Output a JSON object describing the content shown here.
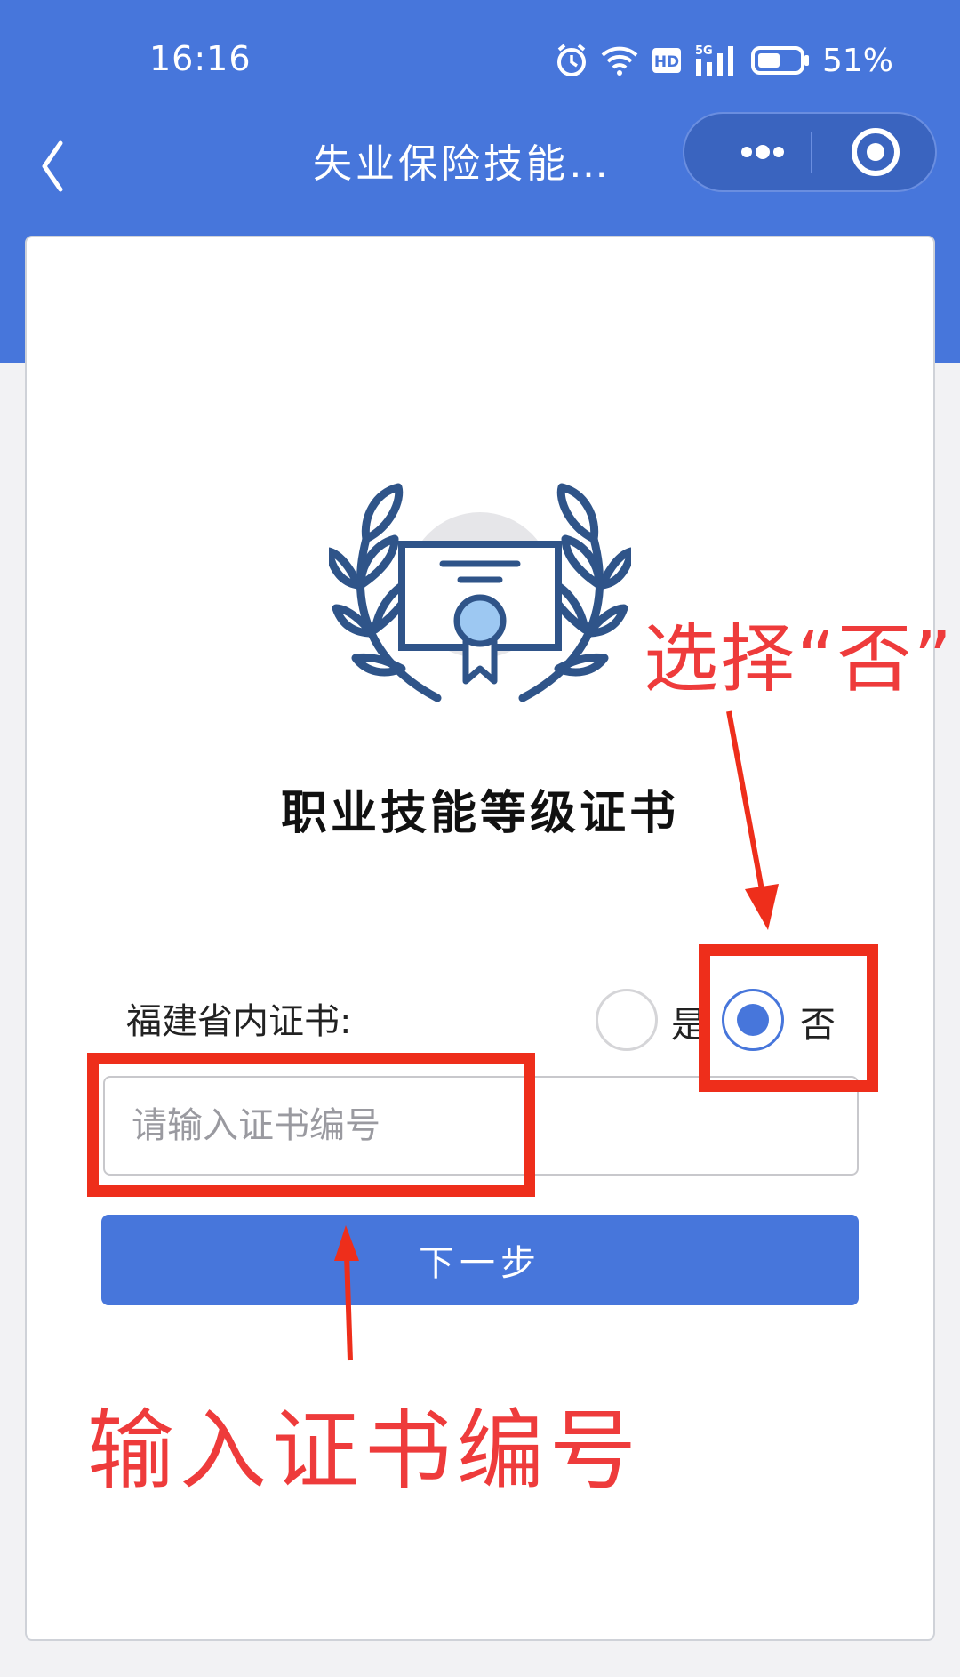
{
  "status_bar": {
    "time": "16:16",
    "battery": "51%",
    "icons": [
      "alarm-icon",
      "wifi-icon",
      "hd-icon",
      "signal-5g-icon",
      "battery-icon"
    ]
  },
  "nav": {
    "title": "失业保险技能…",
    "back_icon": "chevron-left-icon",
    "more_icon": "more-dots-icon",
    "close_icon": "target-close-icon"
  },
  "card": {
    "emblem_icon": "certificate-laurel-icon",
    "title": "职业技能等级证书"
  },
  "form": {
    "label": "福建省内证书:",
    "options": [
      "是",
      "否"
    ],
    "selected": "否",
    "input_placeholder": "请输入证书编号",
    "input_value": "",
    "next_button": "下一步"
  },
  "annotations": {
    "radio_hint": "选择“否”",
    "input_hint": "输入证书编号"
  },
  "colors": {
    "primary": "#4776db",
    "annotation": "#ee2e1b"
  }
}
